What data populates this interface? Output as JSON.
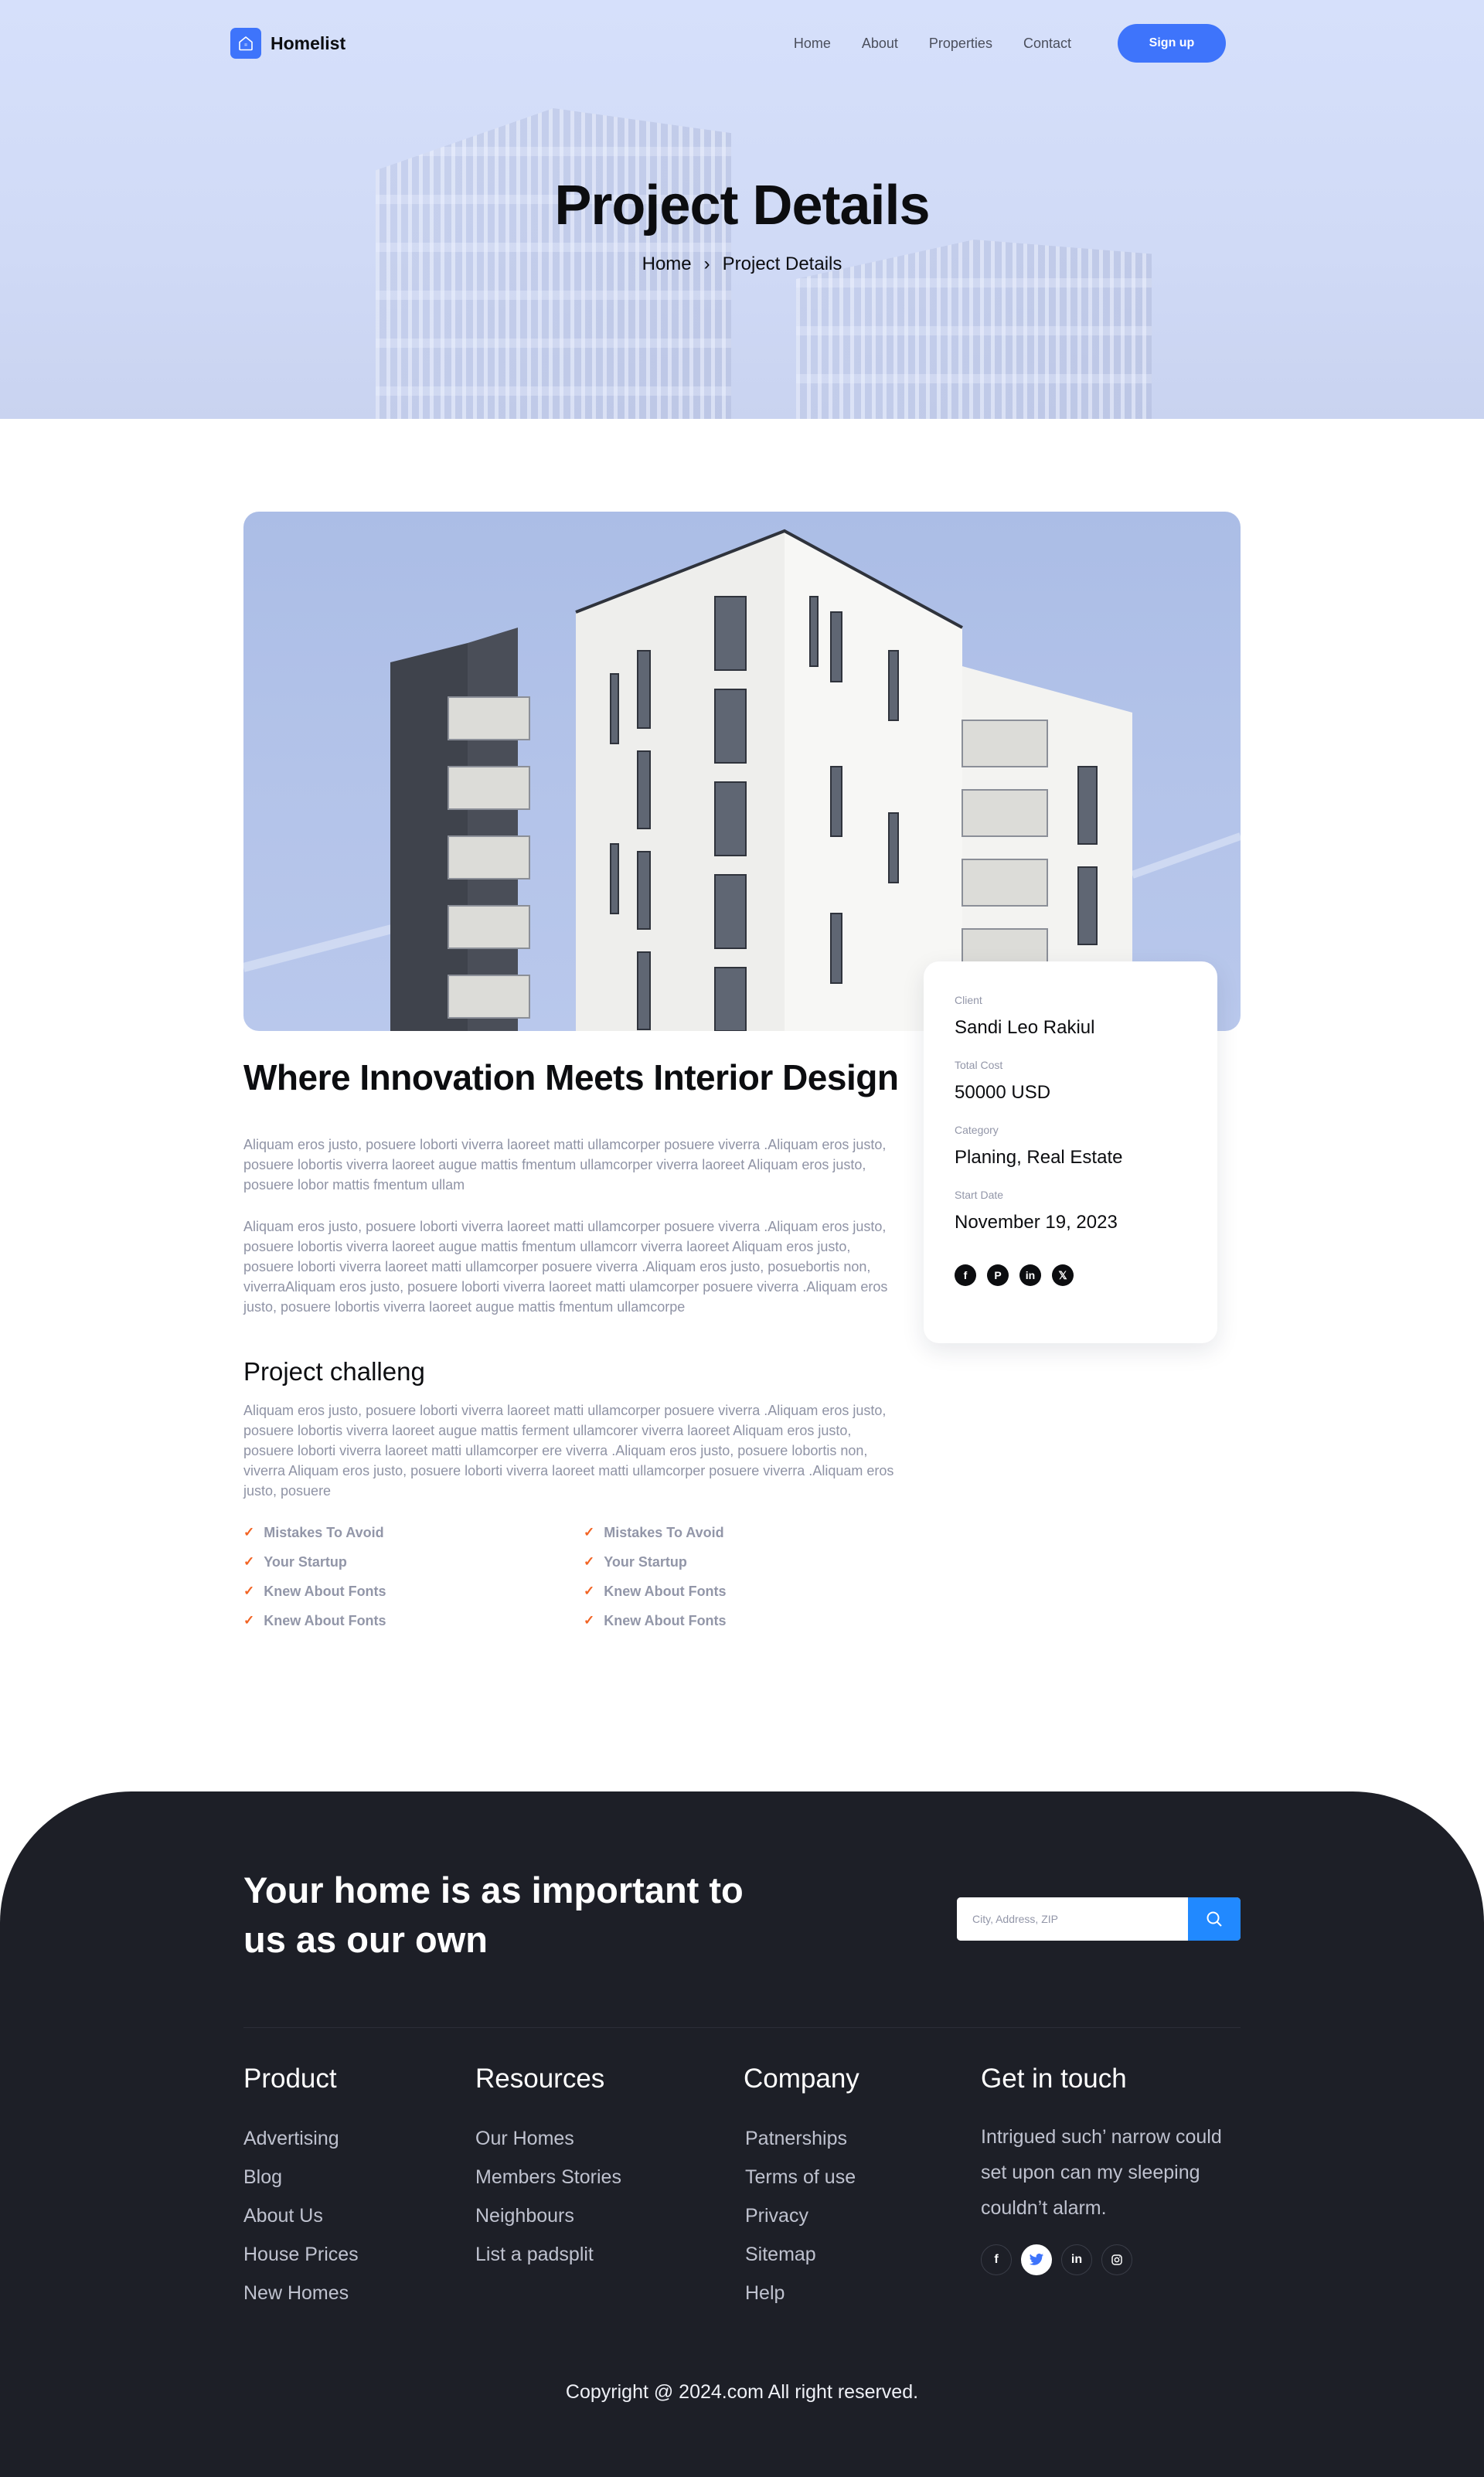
{
  "header": {
    "brand": "Homelist",
    "nav": [
      "Home",
      "About",
      "Properties",
      "Contact"
    ],
    "signup_label": "Sign up"
  },
  "hero": {
    "title": "Project Details",
    "breadcrumb": [
      "Home",
      "Project Details"
    ],
    "separator": "›"
  },
  "project": {
    "heading": "Where Innovation Meets Interior Design",
    "paragraph1": "Aliquam eros justo, posuere loborti viverra laoreet matti ullamcorper posuere viverra .Aliquam eros justo, posuere lobortis  viverra laoreet augue mattis fmentum ullamcorper viverra laoreet Aliquam eros justo, posuere lobor mattis fmentum ullam",
    "paragraph2": "Aliquam eros justo, posuere loborti viverra laoreet matti ullamcorper posuere viverra .Aliquam eros justo, posuere lobortis  viverra laoreet augue mattis fmentum ullamcorr viverra laoreet Aliquam eros justo, posuere loborti viverra laoreet matti ullamcorper posuere viverra .Aliquam eros justo, posuebortis non, viverraAliquam eros justo, posuere loborti viverra laoreet matti ulamcorper posuere viverra .Aliquam eros justo, posuere lobortis  viverra laoreet augue mattis fmentum ullamcorpe",
    "challenge_heading": "Project challeng",
    "challenge_text": "Aliquam eros justo, posuere loborti viverra laoreet matti ullamcorper posuere viverra .Aliquam eros justo, posuere lobortis  viverra laoreet augue mattis ferment ullamcorer viverra laoreet Aliquam eros justo, posuere loborti viverra laoreet matti ullamcorper ere viverra .Aliquam eros justo, posuere lobortis non, viverra Aliquam eros justo, posuere loborti viverra laoreet matti ullamcorper posuere viverra .Aliquam eros justo, posuere",
    "checklist_left": [
      "Mistakes To Avoid",
      "Your Startup",
      "Knew About Fonts",
      "Knew About Fonts"
    ],
    "checklist_right": [
      "Mistakes To Avoid",
      "Your Startup",
      "Knew About Fonts",
      "Knew About Fonts"
    ]
  },
  "info_card": {
    "rows": [
      {
        "label": "Client",
        "value": "Sandi Leo Rakiul"
      },
      {
        "label": "Total Cost",
        "value": "50000 USD"
      },
      {
        "label": "Category",
        "value": "Planing, Real Estate"
      },
      {
        "label": "Start Date",
        "value": "November 19, 2023"
      }
    ],
    "social_icons": [
      "facebook-icon",
      "pinterest-icon",
      "linkedin-icon",
      "x-icon"
    ]
  },
  "footer": {
    "cta": "Your home is as important to us as our own",
    "search_placeholder": "City, Address, ZIP",
    "columns": {
      "product": {
        "title": "Product",
        "links": [
          "Advertising",
          "Blog",
          "About Us",
          "House Prices",
          "New Homes"
        ]
      },
      "resources": {
        "title": "Resources",
        "links": [
          "Our Homes",
          "Members Stories",
          "Neighbours",
          "List a padsplit"
        ]
      },
      "company": {
        "title": "Company",
        "links": [
          "Patnerships",
          "Terms of use",
          "Privacy",
          "Sitemap",
          "Help"
        ]
      }
    },
    "touch": {
      "title": "Get in touch",
      "text": "Intrigued such’ narrow could set upon can my sleeping couldn’t alarm.",
      "social_icons": [
        "facebook-icon",
        "twitter-icon",
        "linkedin-icon",
        "instagram-icon"
      ]
    },
    "copyright": "Copyright @ 2024.com All right  reserved."
  },
  "colors": {
    "accent": "#3e74fb",
    "search_button": "#2189ff",
    "check": "#f26322",
    "footer_bg": "#1d1f27",
    "muted_text": "#8f93a5"
  }
}
